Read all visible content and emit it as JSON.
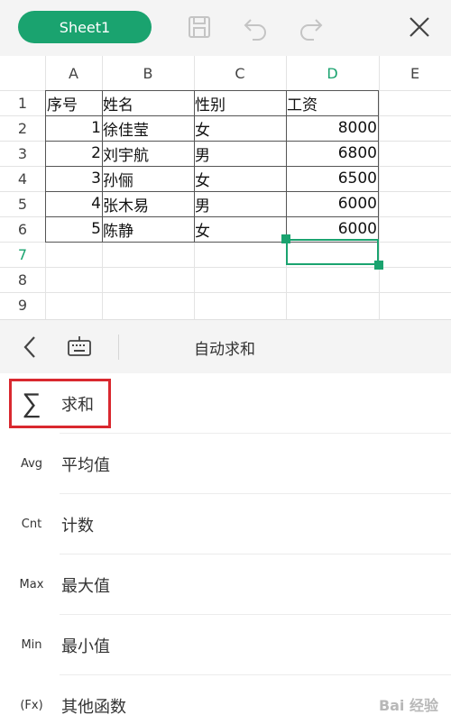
{
  "toolbar": {
    "sheet_name": "Sheet1",
    "icons": [
      "save-icon",
      "undo-icon",
      "redo-icon",
      "close-icon"
    ]
  },
  "grid": {
    "columns": [
      "A",
      "B",
      "C",
      "D",
      "E"
    ],
    "active_column": "D",
    "rows": [
      "1",
      "2",
      "3",
      "4",
      "5",
      "6",
      "7",
      "8",
      "9"
    ],
    "active_row": "7",
    "table": [
      [
        "序号",
        "姓名",
        "性别",
        "工资"
      ],
      [
        "1",
        "徐佳莹",
        "女",
        "8000"
      ],
      [
        "2",
        "刘宇航",
        "男",
        "6800"
      ],
      [
        "3",
        "孙俪",
        "女",
        "6500"
      ],
      [
        "4",
        "张木易",
        "男",
        "6000"
      ],
      [
        "5",
        "陈静",
        "女",
        "6000"
      ]
    ],
    "selected_cell": "D7",
    "accent_color": "#1aa36f"
  },
  "panel": {
    "title": "自动求和",
    "items": [
      {
        "icon": "∑",
        "label": "求和"
      },
      {
        "icon": "Avg",
        "label": "平均值"
      },
      {
        "icon": "Cnt",
        "label": "计数"
      },
      {
        "icon": "Max",
        "label": "最大值"
      },
      {
        "icon": "Min",
        "label": "最小值"
      },
      {
        "icon": "(Fx)",
        "label": "其他函数"
      }
    ],
    "highlight_color": "#d9282f"
  },
  "watermark": "Bai 经验"
}
